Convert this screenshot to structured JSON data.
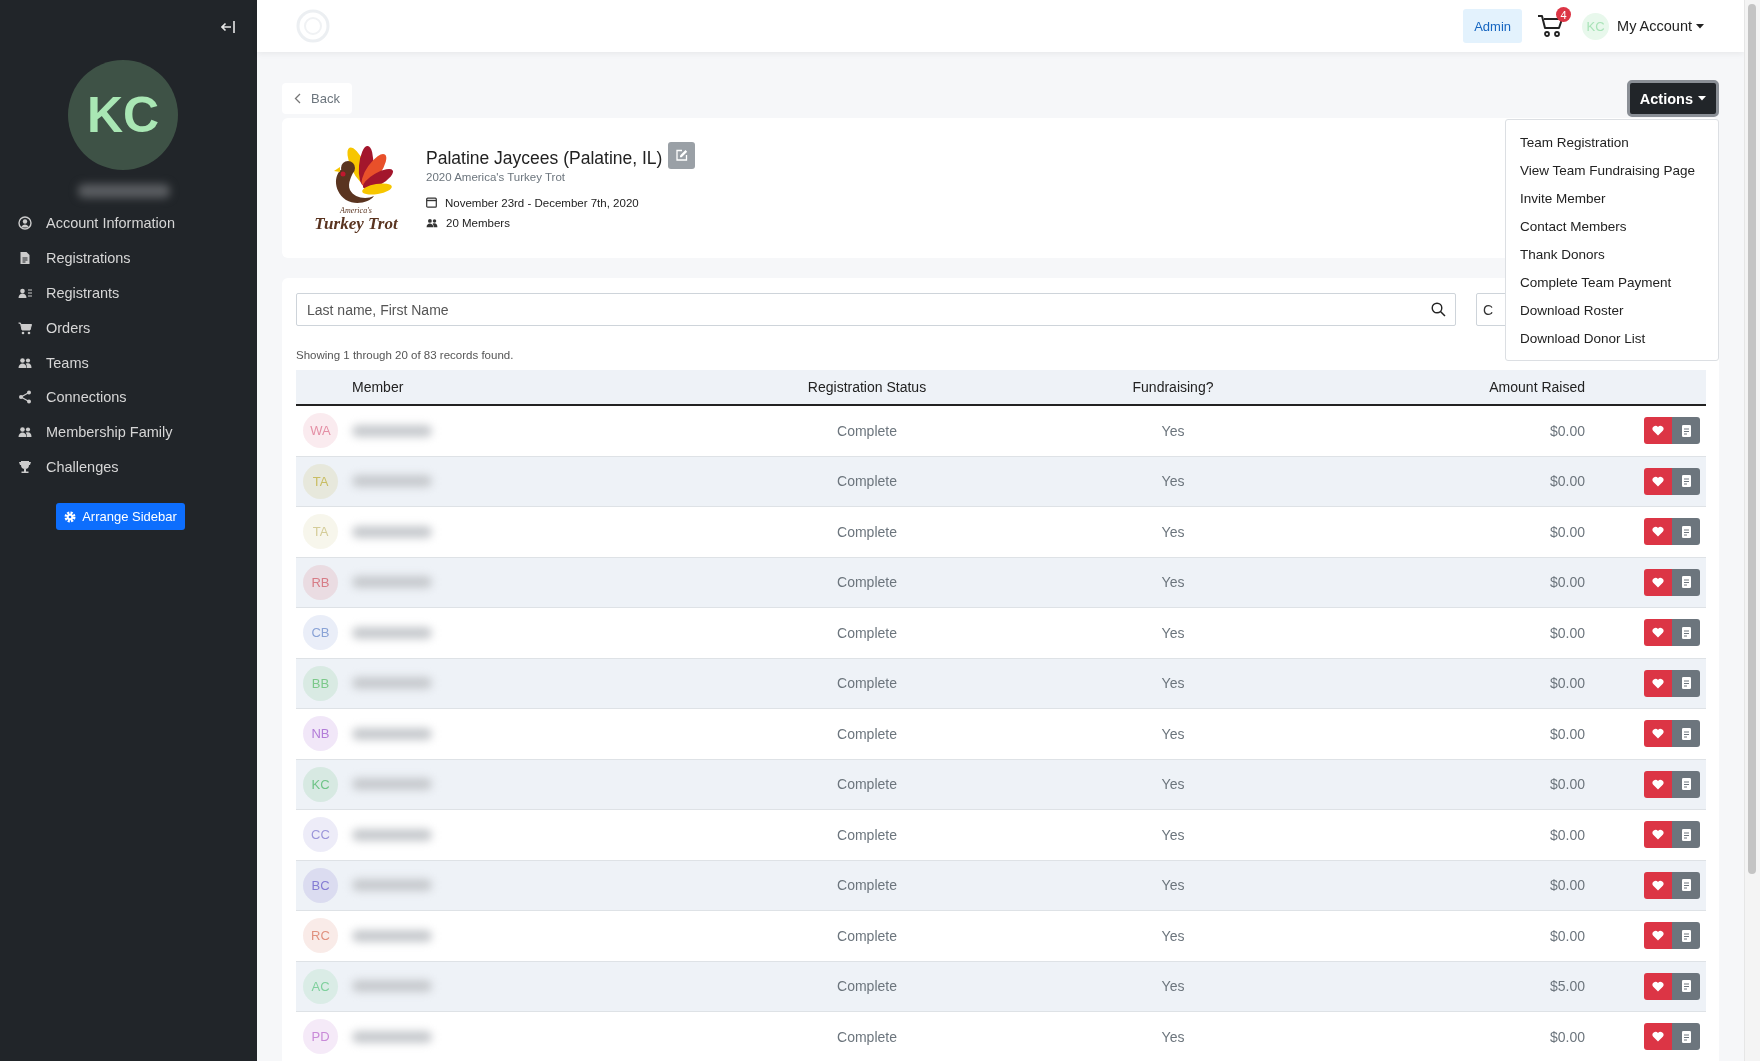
{
  "sidebar": {
    "avatar_initials": "KC",
    "items": [
      {
        "label": "Account Information",
        "kind": "user"
      },
      {
        "label": "Registrations",
        "kind": "file"
      },
      {
        "label": "Registrants",
        "kind": "card"
      },
      {
        "label": "Orders",
        "kind": "cart"
      },
      {
        "label": "Teams",
        "kind": "users"
      },
      {
        "label": "Connections",
        "kind": "share"
      },
      {
        "label": "Membership Family",
        "kind": "users"
      },
      {
        "label": "Challenges",
        "kind": "trophy"
      }
    ],
    "arrange_button": "Arrange Sidebar"
  },
  "topbar": {
    "admin_button": "Admin",
    "cart_count": "4",
    "account_initials": "KC",
    "account_label": "My Account"
  },
  "back_button": "Back",
  "actions": {
    "label": "Actions",
    "menu": [
      "Team Registration",
      "View Team Fundraising Page",
      "Invite Member",
      "Contact Members",
      "Thank Donors",
      "Complete Team Payment",
      "Download Roster",
      "Download Donor List"
    ]
  },
  "team": {
    "logo_lines": [
      "America's",
      "Turkey Trot"
    ],
    "name": "Palatine Jaycees (Palatine, IL)",
    "event": "2020 America's Turkey Trot",
    "dates": "November 23rd - December 7th, 2020",
    "members": "20 Members"
  },
  "search": {
    "placeholder": "Last name, First Name"
  },
  "second_control": "C",
  "records_summary": "Showing 1 through 20 of 83 records found.",
  "table": {
    "columns": [
      "Member",
      "Registration Status",
      "Fundraising?",
      "Amount Raised"
    ],
    "rows": [
      {
        "initials": "WA",
        "color": "#e48fa5",
        "status": "Complete",
        "fundraising": "Yes",
        "amount": "$0.00"
      },
      {
        "initials": "TA",
        "color": "#c9bd62",
        "status": "Complete",
        "fundraising": "Yes",
        "amount": "$0.00"
      },
      {
        "initials": "TA",
        "color": "#d4cc98",
        "status": "Complete",
        "fundraising": "Yes",
        "amount": "$0.00"
      },
      {
        "initials": "RB",
        "color": "#d77c86",
        "status": "Complete",
        "fundraising": "Yes",
        "amount": "$0.00"
      },
      {
        "initials": "CB",
        "color": "#8aa3d6",
        "status": "Complete",
        "fundraising": "Yes",
        "amount": "$0.00"
      },
      {
        "initials": "BB",
        "color": "#7cc98a",
        "status": "Complete",
        "fundraising": "Yes",
        "amount": "$0.00"
      },
      {
        "initials": "NB",
        "color": "#b27cd8",
        "status": "Complete",
        "fundraising": "Yes",
        "amount": "$0.00"
      },
      {
        "initials": "KC",
        "color": "#6fc487",
        "status": "Complete",
        "fundraising": "Yes",
        "amount": "$0.00"
      },
      {
        "initials": "CC",
        "color": "#9b96d9",
        "status": "Complete",
        "fundraising": "Yes",
        "amount": "$0.00"
      },
      {
        "initials": "BC",
        "color": "#847cd3",
        "status": "Complete",
        "fundraising": "Yes",
        "amount": "$0.00"
      },
      {
        "initials": "RC",
        "color": "#e0917f",
        "status": "Complete",
        "fundraising": "Yes",
        "amount": "$0.00"
      },
      {
        "initials": "AC",
        "color": "#7fd09d",
        "status": "Complete",
        "fundraising": "Yes",
        "amount": "$5.00"
      },
      {
        "initials": "PD",
        "color": "#c98ad8",
        "status": "Complete",
        "fundraising": "Yes",
        "amount": "$0.00"
      }
    ]
  }
}
